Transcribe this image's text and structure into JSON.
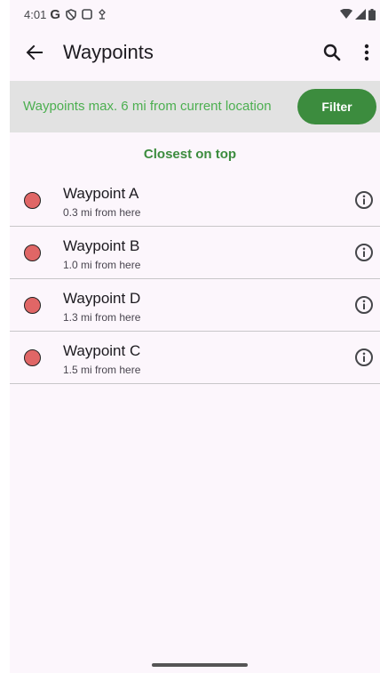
{
  "status_bar": {
    "time": "4:01",
    "icons_left": [
      "google-icon",
      "shield-icon",
      "screen-icon",
      "mic-icon"
    ],
    "icons_right": [
      "wifi-icon",
      "signal-icon",
      "battery-icon"
    ]
  },
  "app_bar": {
    "title": "Waypoints",
    "back_icon": "arrow-back-icon",
    "search_icon": "search-icon",
    "more_icon": "more-vert-icon"
  },
  "filter_banner": {
    "text": "Waypoints max. 6 mi from current location",
    "button_label": "Filter"
  },
  "sort": {
    "label": "Closest on top"
  },
  "waypoints": [
    {
      "name": "Waypoint A",
      "distance": "0.3 mi from here"
    },
    {
      "name": "Waypoint B",
      "distance": "1.0 mi from here"
    },
    {
      "name": "Waypoint D",
      "distance": "1.3 mi from here"
    },
    {
      "name": "Waypoint C",
      "distance": "1.5 mi from here"
    }
  ],
  "colors": {
    "accent": "#3c8c3e",
    "filter_text": "#4caf50",
    "waypoint_marker": "#e06666",
    "banner_background": "#e2e2e2",
    "app_background": "#fcf6fc"
  }
}
